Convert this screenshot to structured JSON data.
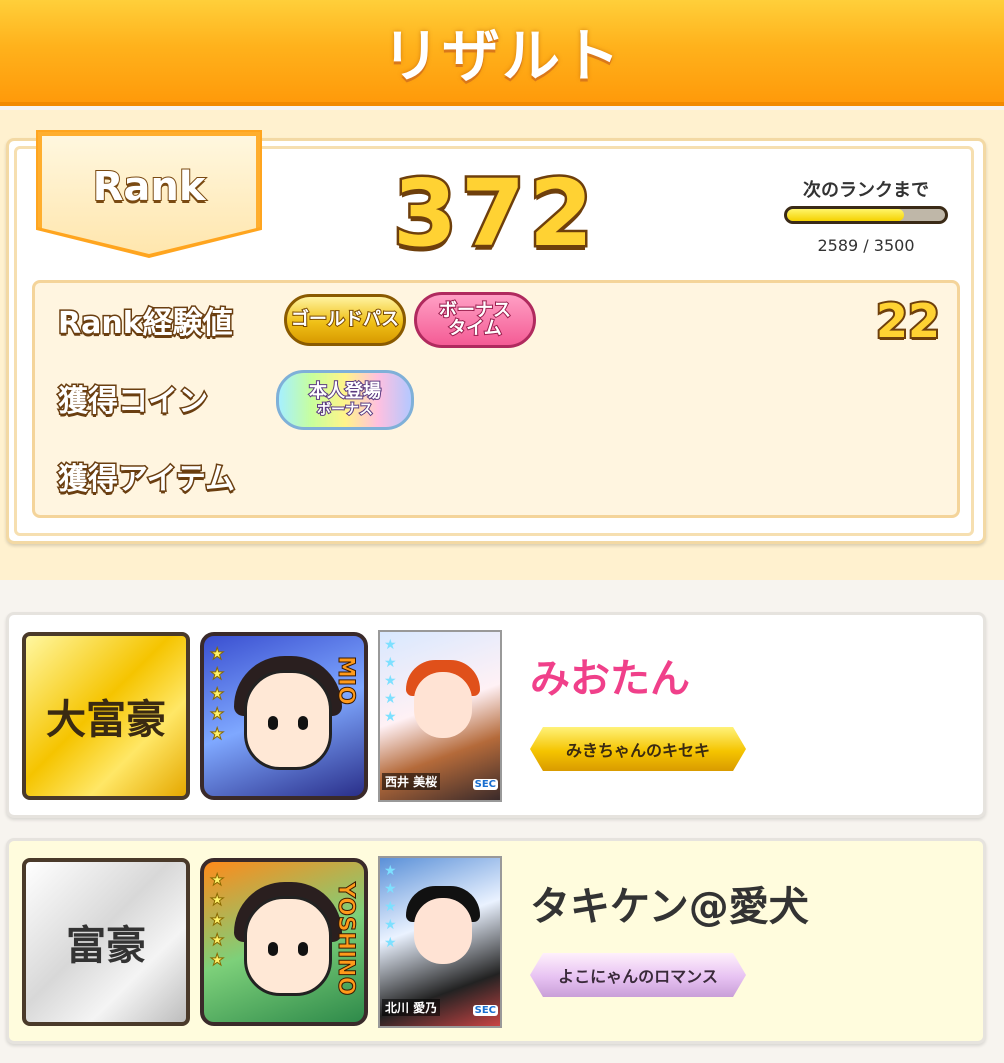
{
  "header": {
    "title": "リザルト"
  },
  "rank": {
    "tag_label": "Rank",
    "value": "372",
    "next_label": "次のランクまで",
    "progress_text": "2589 / 3500",
    "progress_fraction": 0.74
  },
  "stats": {
    "exp_label": "Rank経験値",
    "coin_label": "獲得コイン",
    "item_label": "獲得アイテム",
    "exp_value": "22",
    "badges": {
      "gold_pass": "ゴールドパス",
      "bonus_time": "ボーナスタイム",
      "self_appear_line1": "本人登場",
      "self_appear_line2": "ボーナス"
    }
  },
  "players": [
    {
      "title": "大富豪",
      "avatar_side_text": "MIO",
      "photo_name": "西井 美桜",
      "photo_sec": "SEC",
      "name": "みおたん",
      "honor": "みきちゃんのキセキ"
    },
    {
      "title": "富豪",
      "avatar_side_text": "YOSHINO",
      "photo_name": "北川 愛乃",
      "photo_sec": "SEC",
      "name": "タキケン@愛犬",
      "honor": "よこにゃんのロマンス"
    }
  ],
  "colors": {
    "header_orange": "#ffb21c",
    "gold_text": "#ffd233",
    "pink_name": "#f0408a"
  }
}
